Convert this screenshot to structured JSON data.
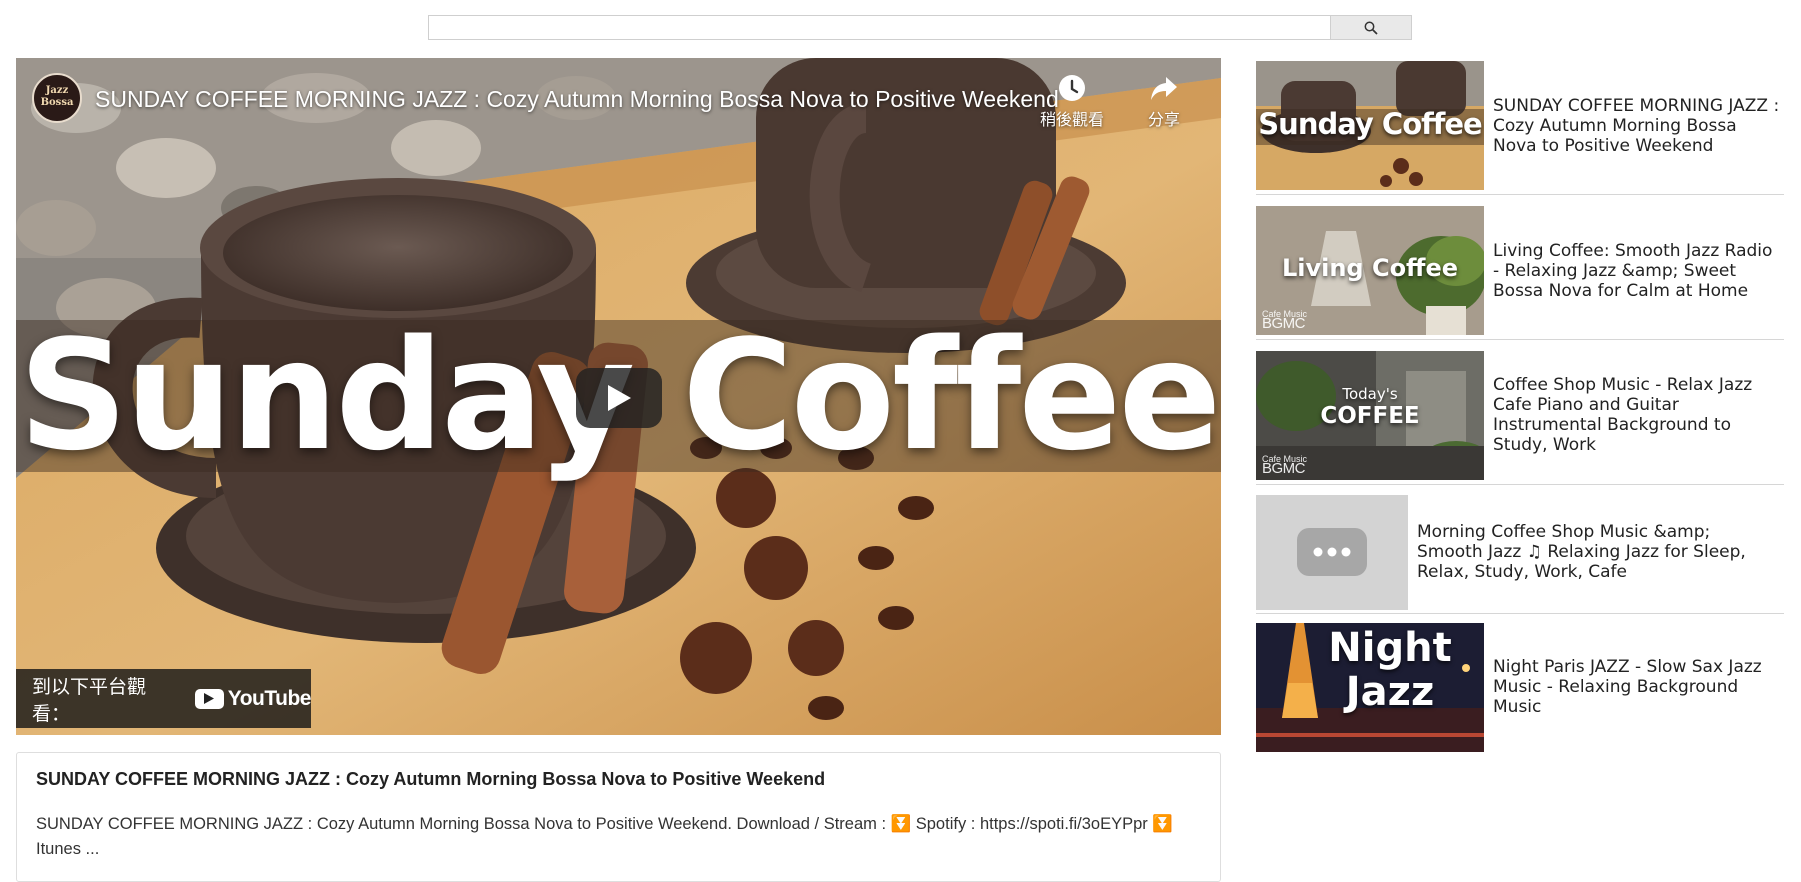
{
  "search": {
    "placeholder": "",
    "value": ""
  },
  "player": {
    "title": "SUNDAY COFFEE MORNING JAZZ : Cozy Autumn Morning Bossa Nova to Positive Weekend",
    "channel_avatar_text": "Jazz Bossa",
    "thumbnail_text": "Sunday Coffee",
    "watch_later_label": "稍後觀看",
    "share_label": "分享",
    "watch_on_label": "到以下平台觀看：",
    "youtube_label": "YouTube"
  },
  "description": {
    "title": "SUNDAY COFFEE MORNING JAZZ : Cozy Autumn Morning Bossa Nova to Positive Weekend",
    "text": "SUNDAY COFFEE MORNING JAZZ : Cozy Autumn Morning Bossa Nova to Positive Weekend. Download / Stream : ⏬ Spotify : https://spoti.fi/3oEYPpr ⏬ Itunes ..."
  },
  "related": [
    {
      "title": "SUNDAY COFFEE MORNING JAZZ : Cozy Autumn Morning Bossa Nova to Positive Weekend",
      "thumb_text": "Sunday Coffee"
    },
    {
      "title": "Living Coffee: Smooth Jazz Radio - Relaxing Jazz &amp; Sweet Bossa Nova for Calm at Home",
      "thumb_text": "Living Coffee",
      "brand_small": "Cafe Music",
      "brand": "BGMC"
    },
    {
      "title": "Coffee Shop Music - Relax Jazz Cafe Piano and Guitar Instrumental Background to Study, Work",
      "thumb_text_top": "Today's",
      "thumb_text": "COFFEE",
      "brand_small": "Cafe Music",
      "brand": "BGMC"
    },
    {
      "title": "Morning Coffee Shop Music &amp; Smooth Jazz ♫ Relaxing Jazz for Sleep, Relax, Study, Work, Cafe",
      "thumb_text": ""
    },
    {
      "title": "Night Paris JAZZ - Slow Sax Jazz Music - Relaxing Background Music",
      "thumb_text_top": "Night",
      "thumb_text": "Jazz"
    }
  ],
  "colors": {
    "accent": "#cc0000",
    "border": "#d6d6d6",
    "search_button": "#e9e9e9"
  },
  "icons": [
    "search-icon",
    "clock-icon",
    "share-icon",
    "play-icon",
    "youtube-icon",
    "more-icon"
  ]
}
